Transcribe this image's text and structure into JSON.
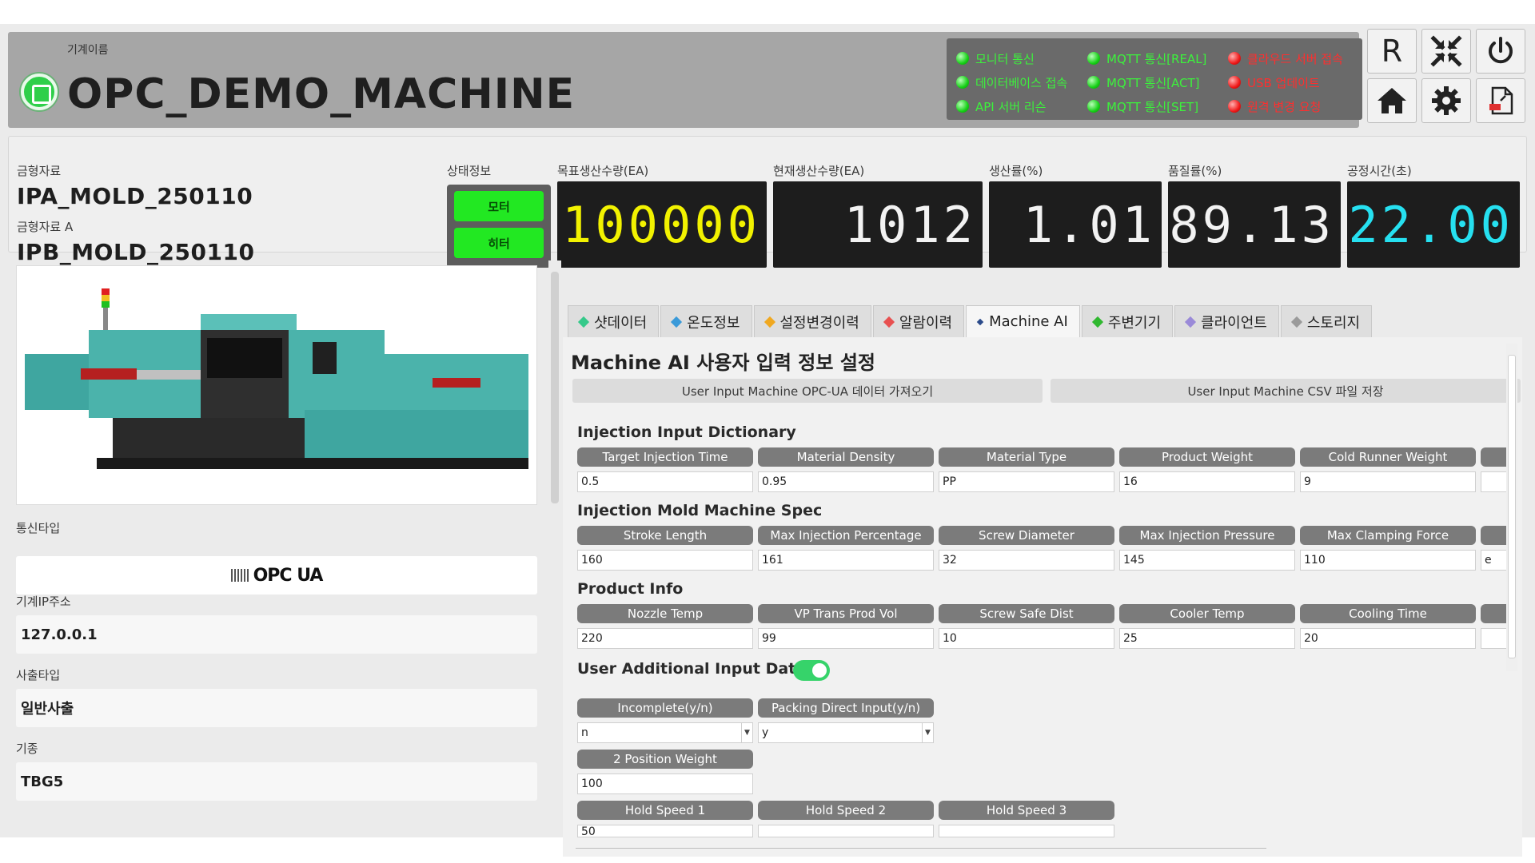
{
  "header": {
    "caption": "기계이름",
    "machine_name": "OPC_DEMO_MACHINE",
    "status_left": [
      {
        "label": "모니터 통신",
        "state": "green"
      },
      {
        "label": "데이터베이스 접속",
        "state": "green"
      },
      {
        "label": "API 서버 리슨",
        "state": "green"
      }
    ],
    "status_mid": [
      {
        "label": "MQTT 통신[REAL]",
        "state": "green"
      },
      {
        "label": "MQTT 통신[ACT]",
        "state": "green"
      },
      {
        "label": "MQTT 통신[SET]",
        "state": "green"
      }
    ],
    "status_right": [
      {
        "label": "클라우드 서버 접속",
        "state": "red"
      },
      {
        "label": "USB 업데이트",
        "state": "red"
      },
      {
        "label": "원격 변경 요청",
        "state": "red"
      }
    ],
    "tools": {
      "r_label": "R"
    }
  },
  "info": {
    "mold_label": "금형자료",
    "mold_value": "IPA_MOLD_250110",
    "mold_a_label": "금형자료 A",
    "mold_a_value": "IPB_MOLD_250110",
    "state_label": "상태정보",
    "motor": "모터",
    "heater": "히터",
    "target_label": "목표생산수량(EA)",
    "target_value": "100000",
    "current_label": "현재생산수량(EA)",
    "current_value": "1012",
    "rate_label": "생산률(%)",
    "rate_value": "1.01",
    "quality_label": "품질률(%)",
    "quality_value": "89.13",
    "cycle_label": "공정시간(초)",
    "cycle_value": "22.00",
    "colors": {
      "target": "#f2f200",
      "current": "#f2f2f2",
      "rate": "#f2f2f2",
      "quality": "#f2f2f2",
      "cycle": "#26e0f0",
      "ok": "#22e822"
    }
  },
  "left": {
    "comm_label": "통신타입",
    "comm_value": "OPC UA",
    "ip_label": "기계IP주소",
    "ip_value": "127.0.0.1",
    "inj_label": "사출타입",
    "inj_value": "일반사출",
    "model_label": "기종",
    "model_value": "TBG5"
  },
  "tabs": [
    {
      "label": "샷데이터",
      "color": "#35c98a"
    },
    {
      "label": "온도정보",
      "color": "#3a9ad9"
    },
    {
      "label": "설정변경이력",
      "color": "#f0a820"
    },
    {
      "label": "알람이력",
      "color": "#e85050"
    },
    {
      "label": "Machine AI",
      "color": "#2a4a8a"
    },
    {
      "label": "주변기기",
      "color": "#30b830"
    },
    {
      "label": "클라이언트",
      "color": "#9a8ad8"
    },
    {
      "label": "스토리지",
      "color": "#9a9a9a"
    }
  ],
  "content": {
    "title": "Machine AI 사용자 입력 정보 설정",
    "btn_opc": "User Input Machine OPC-UA 데이터 가져오기",
    "btn_csv": "User Input Machine CSV 파일 저장",
    "dict_title": "Injection Input Dictionary",
    "dict_labels": [
      "Target Injection Time",
      "Material Density",
      "Material Type",
      "Product Weight",
      "Cold Runner Weight"
    ],
    "dict_values": [
      "0.5",
      "0.95",
      "PP",
      "16",
      "9"
    ],
    "spec_title": "Injection Mold Machine Spec",
    "spec_labels": [
      "Stroke Length",
      "Max Injection Percentage",
      "Screw Diameter",
      "Max Injection Pressure",
      "Max Clamping Force"
    ],
    "spec_values": [
      "160",
      "161",
      "32",
      "145",
      "110"
    ],
    "spec_stub_value": "e",
    "prod_title": "Product Info",
    "prod_labels": [
      "Nozzle Temp",
      "VP Trans Prod Vol",
      "Screw Safe Dist",
      "Cooler Temp",
      "Cooling Time"
    ],
    "prod_values": [
      "220",
      "99",
      "10",
      "25",
      "20"
    ],
    "add_title": "User Additional Input Datas",
    "add_enabled": true,
    "incomplete_label": "Incomplete(y/n)",
    "incomplete_value": "n",
    "packing_label": "Packing Direct Input(y/n)",
    "packing_value": "y",
    "pos_weight_label": "2 Position Weight",
    "pos_weight_value": "100",
    "hold_labels": [
      "Hold Speed 1",
      "Hold Speed 2",
      "Hold Speed 3"
    ],
    "hold_values": [
      "50",
      "",
      ""
    ]
  }
}
